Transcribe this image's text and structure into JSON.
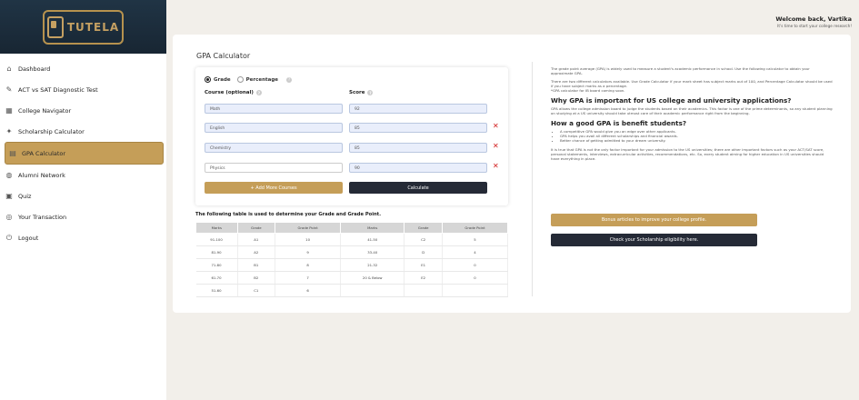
{
  "brand": {
    "name": "TUTELA"
  },
  "nav": [
    {
      "label": "Dashboard",
      "icon": "home-icon",
      "glyph": "⌂"
    },
    {
      "label": "ACT vs SAT Diagnostic Test",
      "icon": "test-icon",
      "glyph": "✎"
    },
    {
      "label": "College Navigator",
      "icon": "building-icon",
      "glyph": "▦"
    },
    {
      "label": "Scholarship Calculator",
      "icon": "graduation-icon",
      "glyph": "✦"
    },
    {
      "label": "GPA Calculator",
      "icon": "calculator-icon",
      "glyph": "▤"
    },
    {
      "label": "Alumni Network",
      "icon": "globe-icon",
      "glyph": "◍"
    },
    {
      "label": "Quiz",
      "icon": "quiz-icon",
      "glyph": "▣"
    },
    {
      "label": "Your Transaction",
      "icon": "transaction-icon",
      "glyph": "◎"
    },
    {
      "label": "Logout",
      "icon": "logout-icon",
      "glyph": "⏻"
    }
  ],
  "welcome": {
    "title": "Welcome back, Vartika",
    "subtitle": "It's time to start your college research!"
  },
  "page_title": "GPA Calculator",
  "form": {
    "mode_grade": "Grade",
    "mode_percentage": "Percentage",
    "course_label": "Course (optional)",
    "score_label": "Score",
    "rows": [
      {
        "course": "Math",
        "score": "92"
      },
      {
        "course": "English",
        "score": "85"
      },
      {
        "course": "Chemistry",
        "score": "85"
      },
      {
        "course": "Physics",
        "score": "90"
      }
    ],
    "add_label": "+ Add More Courses",
    "calc_label": "Calculate"
  },
  "table": {
    "caption": "The following table is used to determine your Grade and Grade Point.",
    "headers": [
      "Marks",
      "Grade",
      "Grade Point",
      "Marks",
      "Grade",
      "Grade Point"
    ],
    "rows": [
      [
        "91-100",
        "A1",
        "10",
        "41-50",
        "C2",
        "5"
      ],
      [
        "81-90",
        "A2",
        "9",
        "33-40",
        "D",
        "4"
      ],
      [
        "71-80",
        "B1",
        "8",
        "21-32",
        "E1",
        "0"
      ],
      [
        "61-70",
        "B2",
        "7",
        "20 & Below",
        "E2",
        "0"
      ],
      [
        "51-60",
        "C1",
        "6",
        "",
        "",
        ""
      ]
    ]
  },
  "info": {
    "p1": "The grade point average (GPA) is widely used to measure a student's academic performance in school. Use the following calculator to obtain your approximate GPA.",
    "p2": "There are two different calculators available. Use Grade Calculator if your mark sheet has subject marks out of 100, and Percentage Calculator should be used if you have subject marks as a percentage.",
    "p2b": "*GPA calculator for IB board coming soon.",
    "h1": "Why GPA is important for US college and university applications?",
    "p3": "GPA allows the college admission board to judge the students based on their academics. This factor is one of the prime determinants, so any student planning on studying at a US university should take utmost care of their academic performance right from the beginning.",
    "h2": "How a good GPA is benefit students?",
    "bullets": [
      "A competitive GPA would give you an edge over other applicants.",
      "GPA helps you avail all different scholarships and financial awards.",
      "Better chance of getting admitted to your dream university."
    ],
    "p4": "It is true that GPA is not the only factor important for your admission to the US universities; there are other important factors such as your ACT/SAT score, personal statements, interviews, extracurricular activities, recommendations, etc. So, every student aiming for higher education in US universities should have everything in place.",
    "btn_bonus": "Bonus articles to improve your college profile.",
    "btn_scholar": "Check your Scholarship eligibility here."
  },
  "colors": {
    "gold": "#c59e58",
    "dark": "#252a36",
    "sidebar_header": "#1e3142",
    "remove": "#d21f1f"
  }
}
